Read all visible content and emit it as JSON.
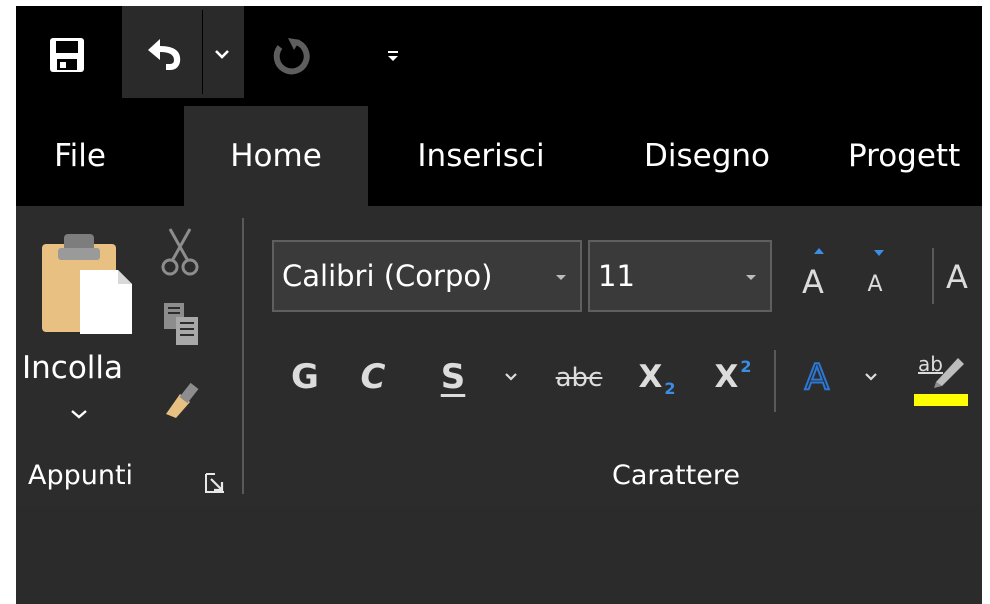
{
  "tabs": [
    {
      "label": "File"
    },
    {
      "label": "Home"
    },
    {
      "label": "Inserisci"
    },
    {
      "label": "Disegno"
    },
    {
      "label": "Progett"
    }
  ],
  "clipboard": {
    "paste_label": "Incolla",
    "group_label": "Appunti"
  },
  "font": {
    "font_name": "Calibri (Corpo)",
    "font_size": "11",
    "group_label": "Carattere",
    "grow_label": "A",
    "shrink_label": "A",
    "clear_label": "A",
    "bold_label": "G",
    "italic_label": "C",
    "underline_label": "S",
    "strike_label": "abc",
    "sub_base": "X",
    "sub_index": "2",
    "super_base": "X",
    "super_index": "2",
    "effects_label": "A",
    "highlight_label": "ab"
  },
  "colors": {
    "highlight": "#ffff00",
    "accent_blue": "#3a8ee6",
    "text_effect_blue": "#2b78d6"
  }
}
